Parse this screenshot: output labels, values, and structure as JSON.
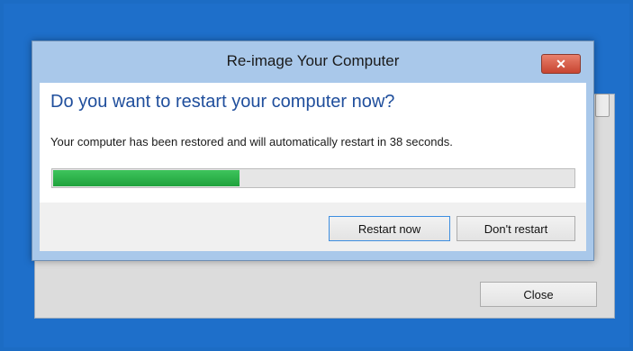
{
  "background_window": {
    "close_label": "Close"
  },
  "dialog": {
    "title": "Re-image Your Computer",
    "close_glyph": "✕",
    "heading": "Do you want to restart your computer now?",
    "message": "Your computer has been restored and will automatically restart in 38 seconds.",
    "progress_fraction": 0.36,
    "buttons": {
      "restart_now": "Restart now",
      "dont_restart": "Don't restart"
    }
  },
  "colors": {
    "desktop": "#1e6fca",
    "heading": "#1f4e9c",
    "progress": "#2fb34c",
    "close_button": "#c74431"
  }
}
